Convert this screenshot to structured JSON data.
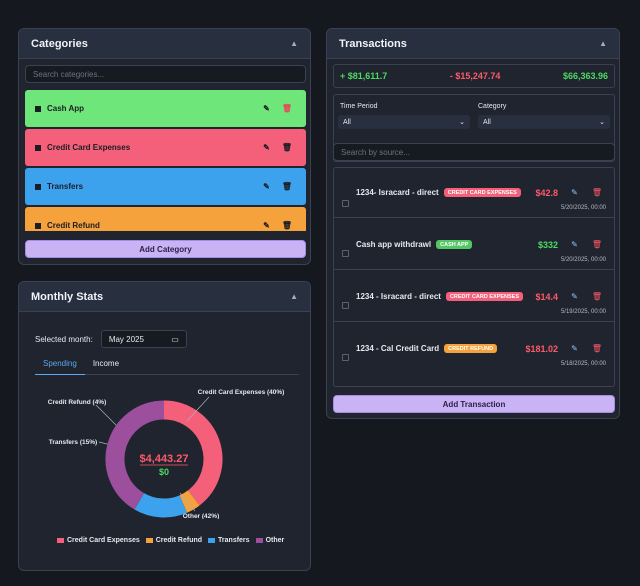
{
  "categories": {
    "title": "Categories",
    "search_placeholder": "Search categories...",
    "items": [
      {
        "label": "Cash App",
        "color": "#6ee67a"
      },
      {
        "label": "Credit Card Expenses",
        "color": "#f4607a"
      },
      {
        "label": "Transfers",
        "color": "#3da2ee"
      },
      {
        "label": "Credit Refund",
        "color": "#f6a23c"
      }
    ],
    "add_label": "Add Category"
  },
  "stats": {
    "title": "Monthly Stats",
    "month_label": "Selected month:",
    "month_value": "May 2025",
    "tabs": [
      "Spending",
      "Income"
    ],
    "total_spending": "$4,443.27",
    "total_income": "$0",
    "chart_data": {
      "type": "pie",
      "categories": [
        "Credit Card Expenses",
        "Credit Refund",
        "Transfers",
        "Other"
      ],
      "values": [
        40,
        4,
        15,
        42
      ],
      "colors": [
        "#f4607a",
        "#f6a23c",
        "#3da2ee",
        "#9b4f9c"
      ],
      "slice_labels": [
        "Credit Card Expenses (40%)",
        "Credit Refund (4%)",
        "Transfers (15%)",
        "Other (42%)"
      ],
      "legend": [
        "Credit Card Expenses",
        "Credit Refund",
        "Transfers",
        "Other"
      ]
    }
  },
  "transactions": {
    "title": "Transactions",
    "income_total": "+ $81,611.7",
    "expense_total": "- $15,247.74",
    "net_total": "$66,363.96",
    "time_period_label": "Time Period",
    "time_period_value": "All",
    "category_label": "Category",
    "category_value": "All",
    "search_placeholder": "Search by source...",
    "items": [
      {
        "name": "1234- Isracard - direct",
        "tag": "CREDIT CARD EXPENSES",
        "tag_color": "#f4607a",
        "amount": "$42.8",
        "amount_color": "#ff5a6a",
        "date": "5/20/2025, 00:00"
      },
      {
        "name": "Cash app withdrawl",
        "tag": "CASH APP",
        "tag_color": "#52c764",
        "amount": "$332",
        "amount_color": "#4cd964",
        "date": "5/20/2025, 00:00"
      },
      {
        "name": "1234 - Isracard - direct",
        "tag": "CREDIT CARD EXPENSES",
        "tag_color": "#f4607a",
        "amount": "$14.4",
        "amount_color": "#ff5a6a",
        "date": "5/19/2025, 00:00"
      },
      {
        "name": "1234 - Cal Credit Card",
        "tag": "CREDIT REFUND",
        "tag_color": "#f6a23c",
        "amount": "$181.02",
        "amount_color": "#ff5a6a",
        "date": "5/18/2025, 00:00"
      }
    ],
    "add_label": "Add Transaction"
  },
  "colors": {
    "income": "#4cd964",
    "expense": "#ff5a6a",
    "accent": "#5aa8f0",
    "button": "#c9b3f5"
  }
}
